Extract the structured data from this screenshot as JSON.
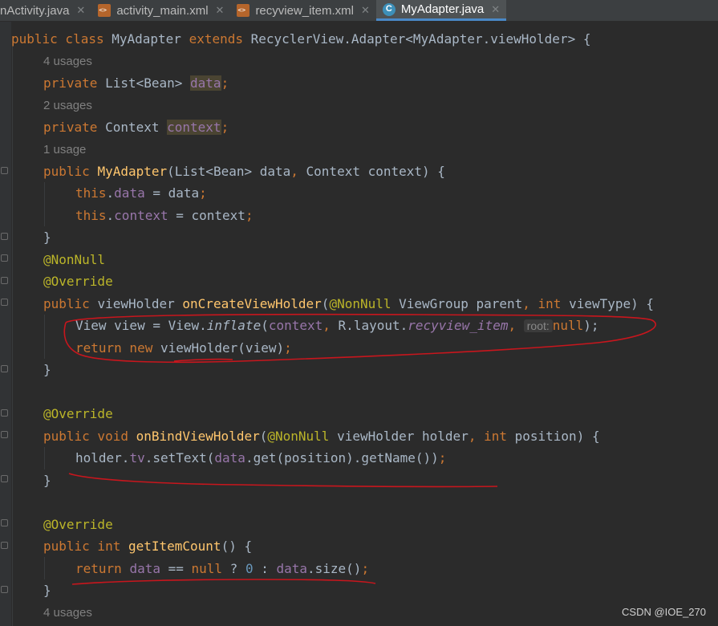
{
  "tabs": [
    {
      "label": "nActivity.java",
      "close": "✕"
    },
    {
      "label": "activity_main.xml",
      "close": "✕"
    },
    {
      "label": "recyview_item.xml",
      "close": "✕"
    },
    {
      "label": "MyAdapter.java",
      "close": "✕"
    }
  ],
  "hints": {
    "usages4": "4 usages",
    "usages2": "2 usages",
    "usage1": "1 usage",
    "usages4b": "4 usages"
  },
  "code": {
    "l1": {
      "a": "public class ",
      "b": "MyAdapter ",
      "c": "extends ",
      "d": "RecyclerView.Adapter<MyAdapter.viewHolder> {"
    },
    "l2": {
      "a": "private ",
      "b": "List<Bean> ",
      "c": "data",
      "d": ";"
    },
    "l3": {
      "a": "private ",
      "b": "Context ",
      "c": "context",
      "d": ";"
    },
    "l4": {
      "a": "public ",
      "b": "MyAdapter",
      "c": "(List<Bean> data",
      "d": ", ",
      "e": "Context context) {"
    },
    "l5": {
      "a": "this",
      "b": ".",
      "c": "data",
      "d": " = data",
      "e": ";"
    },
    "l6": {
      "a": "this",
      "b": ".",
      "c": "context",
      "d": " = context",
      "e": ";"
    },
    "l7": {
      "a": "}"
    },
    "l8": {
      "a": "@NonNull"
    },
    "l9": {
      "a": "@Override"
    },
    "l10": {
      "a": "public ",
      "b": "viewHolder ",
      "c": "onCreateViewHolder",
      "d": "(",
      "e": "@NonNull ",
      "f": "ViewGroup parent",
      "g": ", ",
      "h": "int ",
      "i": "viewType) {"
    },
    "l11": {
      "a": "View view = View.",
      "b": "inflate",
      "c": "(",
      "d": "context",
      "e": ", ",
      "f": "R.layout.",
      "g": "recyview_item",
      "h": ", ",
      "i": "root:",
      "j": "null",
      "k": ");"
    },
    "l12": {
      "a": "return new ",
      "b": "viewHolder(view)",
      "c": ";"
    },
    "l13": {
      "a": "}"
    },
    "l14": {
      "a": "@Override"
    },
    "l15": {
      "a": "public void ",
      "b": "onBindViewHolder",
      "c": "(",
      "d": "@NonNull ",
      "e": "viewHolder holder",
      "f": ", ",
      "g": "int ",
      "h": "position) {"
    },
    "l16": {
      "a": "holder.",
      "b": "tv",
      "c": ".setText(",
      "d": "data",
      "e": ".get(position).getName())",
      "f": ";"
    },
    "l17": {
      "a": "}"
    },
    "l18": {
      "a": "@Override"
    },
    "l19": {
      "a": "public int ",
      "b": "getItemCount",
      "c": "() {"
    },
    "l20": {
      "a": "return ",
      "b": "data",
      "c": " == ",
      "d": "null ",
      "e": "? ",
      "f": "0 ",
      "g": ": ",
      "h": "data",
      "i": ".size()",
      "j": ";"
    },
    "l21": {
      "a": "}"
    }
  },
  "watermark": "CSDN @IOE_270",
  "colors": {
    "annotation_ink": "#c8161d",
    "keyword": "#cc7832",
    "method": "#ffc66d",
    "field": "#9876aa",
    "annotation": "#bbb529"
  }
}
